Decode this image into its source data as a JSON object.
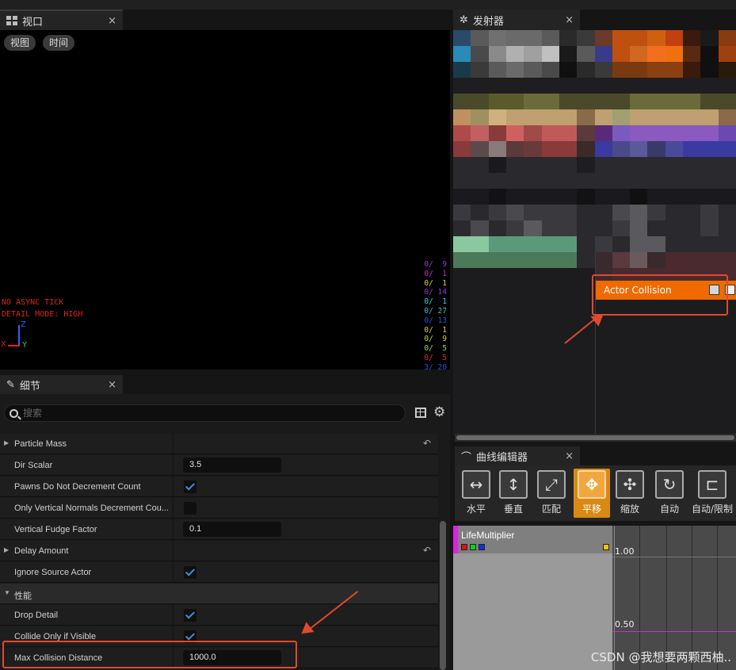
{
  "viewport": {
    "tab_label": "视口",
    "close": "×",
    "btn_view": "视图",
    "btn_time": "时间",
    "warn_async": "NO ASYNC TICK",
    "warn_detail": "DETAIL MODE: HIGH",
    "axis_x": "X",
    "axis_y": "Y",
    "axis_z": "Z",
    "stats": [
      {
        "text": "0/  9",
        "color": "#8a3ad8"
      },
      {
        "text": "0/  1",
        "color": "#c030c0"
      },
      {
        "text": "0/  1",
        "color": "#d8d830"
      },
      {
        "text": "0/ 14",
        "color": "#8a3ad8"
      },
      {
        "text": "0/  1",
        "color": "#30d8d8"
      },
      {
        "text": "0/ 27",
        "color": "#30c0c0"
      },
      {
        "text": "0/ 13",
        "color": "#3050d8"
      },
      {
        "text": "0/  1",
        "color": "#d8d830"
      },
      {
        "text": "0/  9",
        "color": "#c8d830"
      },
      {
        "text": "0/  5",
        "color": "#a0d830"
      },
      {
        "text": "0/  5",
        "color": "#d83030"
      },
      {
        "text": "3/ 20",
        "color": "#3050d8"
      }
    ]
  },
  "emitter": {
    "tab_label": "发射器",
    "close": "×",
    "actor_collision_label": "Actor Collision"
  },
  "details": {
    "tab_label": "细节",
    "close": "×",
    "search_placeholder": "搜索",
    "rows": [
      {
        "label": "Particle Mass",
        "type": "expand",
        "reset": true
      },
      {
        "label": "Dir Scalar",
        "type": "number",
        "value": "3.5"
      },
      {
        "label": "Pawns Do Not Decrement Count",
        "type": "checkbox",
        "checked": true
      },
      {
        "label": "Only Vertical Normals Decrement Cou...",
        "type": "checkbox",
        "checked": false
      },
      {
        "label": "Vertical Fudge Factor",
        "type": "number",
        "value": "0.1"
      },
      {
        "label": "Delay Amount",
        "type": "expand",
        "reset": true
      },
      {
        "label": "Ignore Source Actor",
        "type": "checkbox",
        "checked": true
      },
      {
        "label": "性能",
        "type": "category"
      },
      {
        "label": "Drop Detail",
        "type": "checkbox",
        "checked": true
      },
      {
        "label": "Collide Only if Visible",
        "type": "checkbox",
        "checked": true
      },
      {
        "label": "Max Collision Distance",
        "type": "number",
        "value": "1000.0"
      }
    ]
  },
  "curve_editor": {
    "tab_label": "曲线编辑器",
    "close": "×",
    "tools": [
      {
        "label": "水平",
        "icon": "fit-horizontal-icon",
        "glyph": "↔"
      },
      {
        "label": "垂直",
        "icon": "fit-vertical-icon",
        "glyph": "↕"
      },
      {
        "label": "匹配",
        "icon": "fit-icon",
        "glyph": "⤢"
      },
      {
        "label": "平移",
        "icon": "pan-icon",
        "glyph": "✥",
        "active": true
      },
      {
        "label": "缩放",
        "icon": "zoom-icon",
        "glyph": "✣"
      },
      {
        "label": "自动",
        "icon": "auto-tangent-icon",
        "glyph": "↻"
      },
      {
        "label": "自动/限制",
        "icon": "auto-clamped-icon",
        "glyph": "⊏"
      }
    ],
    "curve_name": "LifeMultiplier",
    "y_label_top": "1.00",
    "y_label_mid": "0.50"
  },
  "watermark": "CSDN @我想要两颗西柚.."
}
